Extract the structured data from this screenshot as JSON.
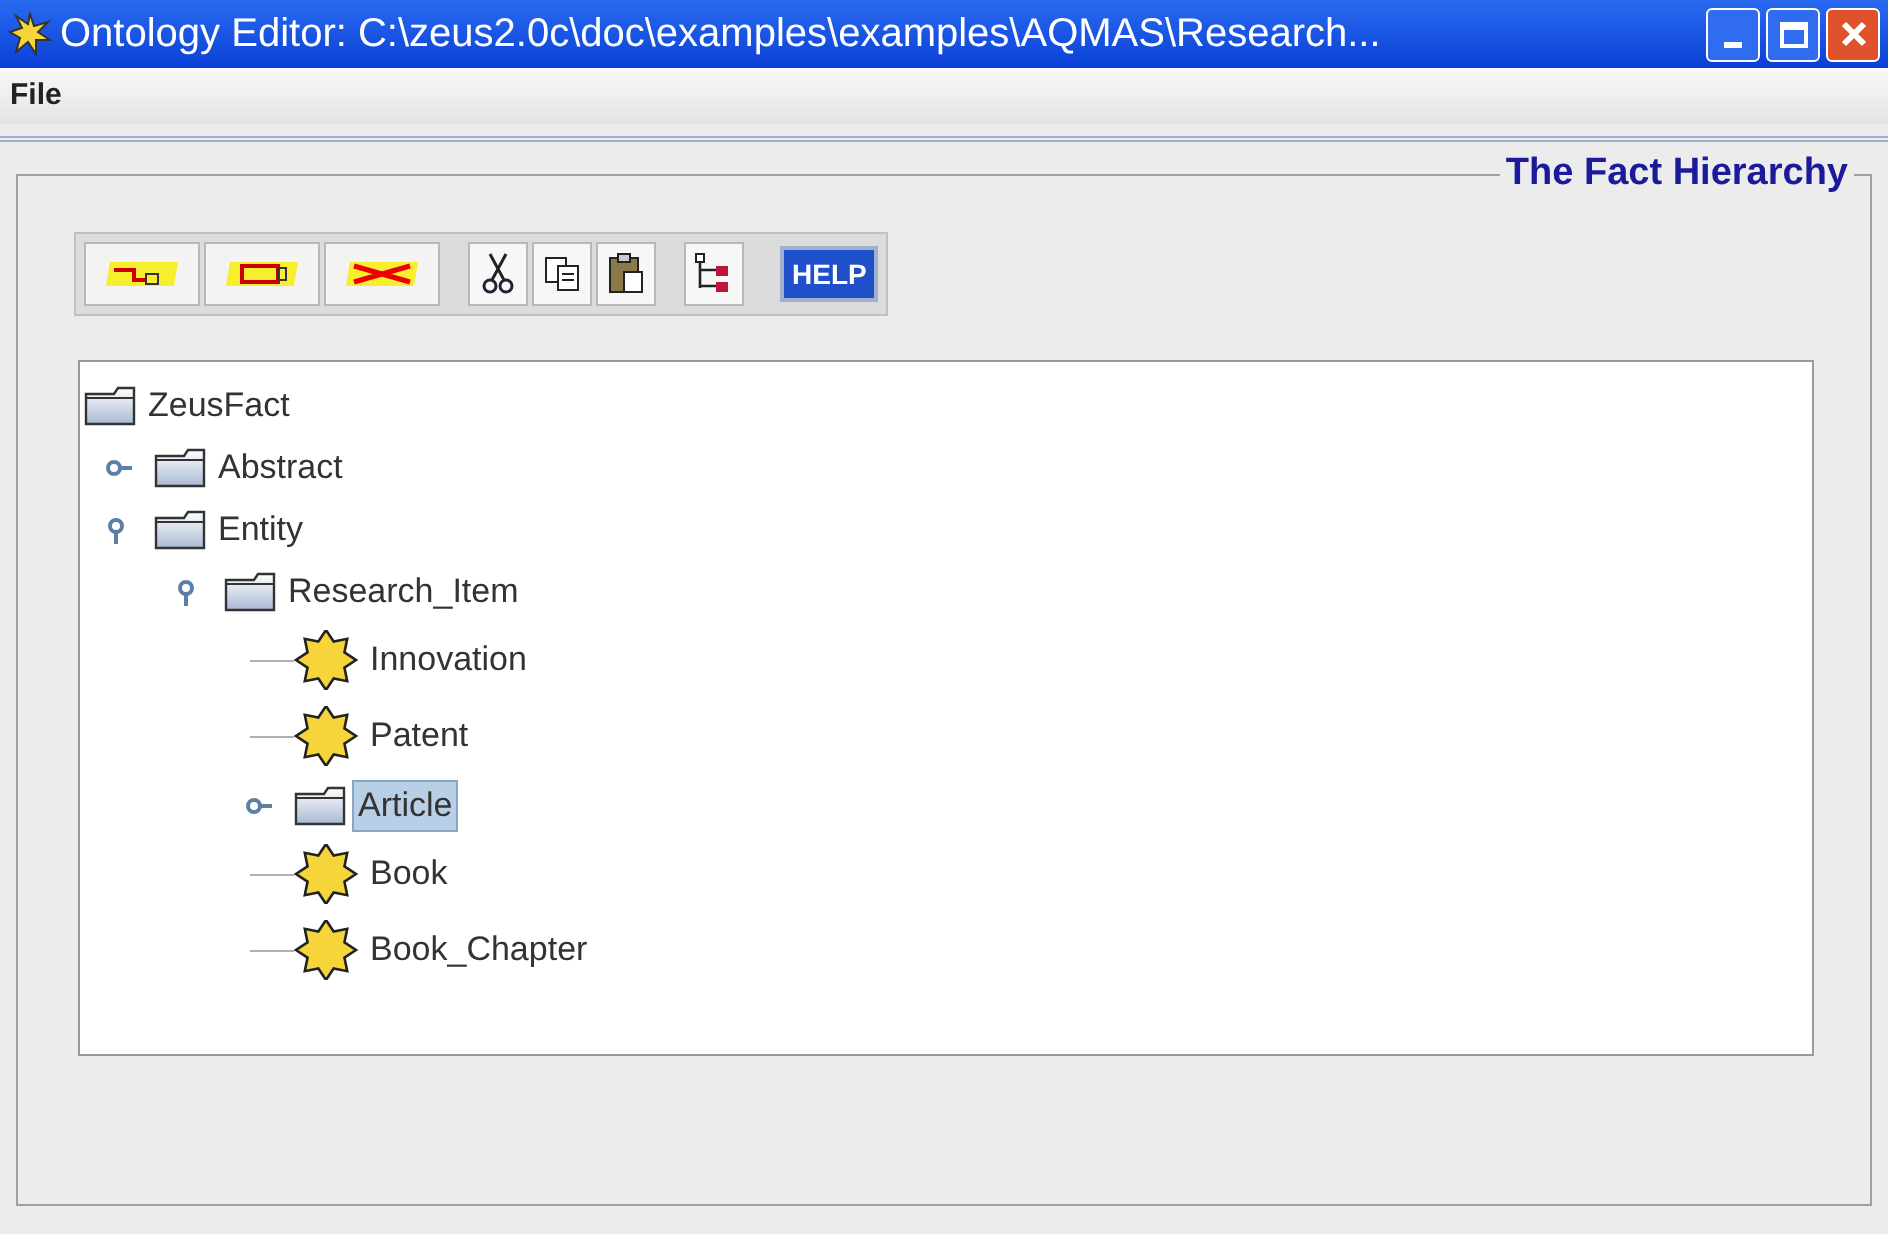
{
  "window": {
    "title": "Ontology Editor: C:\\zeus2.0c\\doc\\examples\\examples\\AQMAS\\Research..."
  },
  "menu": [
    "File"
  ],
  "panel": {
    "title": "The Fact Hierarchy"
  },
  "toolbar": {
    "help_label": "HELP"
  },
  "tree": {
    "label": "ZeusFact",
    "kind": "folder",
    "selected": false,
    "children": [
      {
        "label": "Abstract",
        "kind": "folder",
        "expanded": false,
        "selected": false
      },
      {
        "label": "Entity",
        "kind": "folder",
        "expanded": true,
        "selected": false,
        "children": [
          {
            "label": "Research_Item",
            "kind": "folder",
            "expanded": true,
            "selected": false,
            "children": [
              {
                "label": "Innovation",
                "kind": "fact",
                "selected": false
              },
              {
                "label": "Patent",
                "kind": "fact",
                "selected": false
              },
              {
                "label": "Article",
                "kind": "folder",
                "expanded": false,
                "selected": true
              },
              {
                "label": "Book",
                "kind": "fact",
                "selected": false
              },
              {
                "label": "Book_Chapter",
                "kind": "fact",
                "selected": false
              }
            ]
          }
        ]
      }
    ]
  }
}
